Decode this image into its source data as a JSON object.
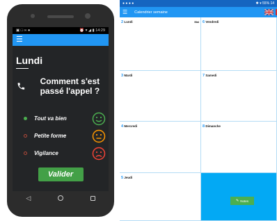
{
  "phone": {
    "status": {
      "left_icons": "▣ □ ∞ ●",
      "right_icons": "⏰ ▾ ◢ ▮",
      "time": "14:29"
    },
    "menu_icon": "hamburger-icon",
    "day": "Lundi",
    "question": "Comment s'est passé l'appel ?",
    "options": [
      {
        "label": "Tout va bien",
        "selected": true,
        "mood": "happy",
        "color": "#4caf50"
      },
      {
        "label": "Petite forme",
        "selected": false,
        "mood": "neutral",
        "color": "#ff9800"
      },
      {
        "label": "Vigilance",
        "selected": false,
        "mood": "sad",
        "color": "#f44336"
      }
    ],
    "validate_label": "Valider",
    "nav": {
      "back": "◁"
    }
  },
  "tablet": {
    "status": {
      "left_icons": "● ● ● ●",
      "right_icons": "✱ ▾ 55%",
      "time": "14"
    },
    "title": "Calendrier semaine",
    "days": [
      {
        "num": "2",
        "name": "Lundi",
        "extra": "Mai"
      },
      {
        "num": "6",
        "name": "Vendredi",
        "extra": ""
      },
      {
        "num": "3",
        "name": "Mardi",
        "extra": ""
      },
      {
        "num": "7",
        "name": "Samedi",
        "extra": ""
      },
      {
        "num": "4",
        "name": "Mercredi",
        "extra": ""
      },
      {
        "num": "8",
        "name": "Dimanche",
        "extra": ""
      },
      {
        "num": "5",
        "name": "Jeudi",
        "extra": ""
      }
    ],
    "notes_label": "Notes",
    "accent": "#2196f3",
    "notes_bg": "#03a9f4"
  }
}
